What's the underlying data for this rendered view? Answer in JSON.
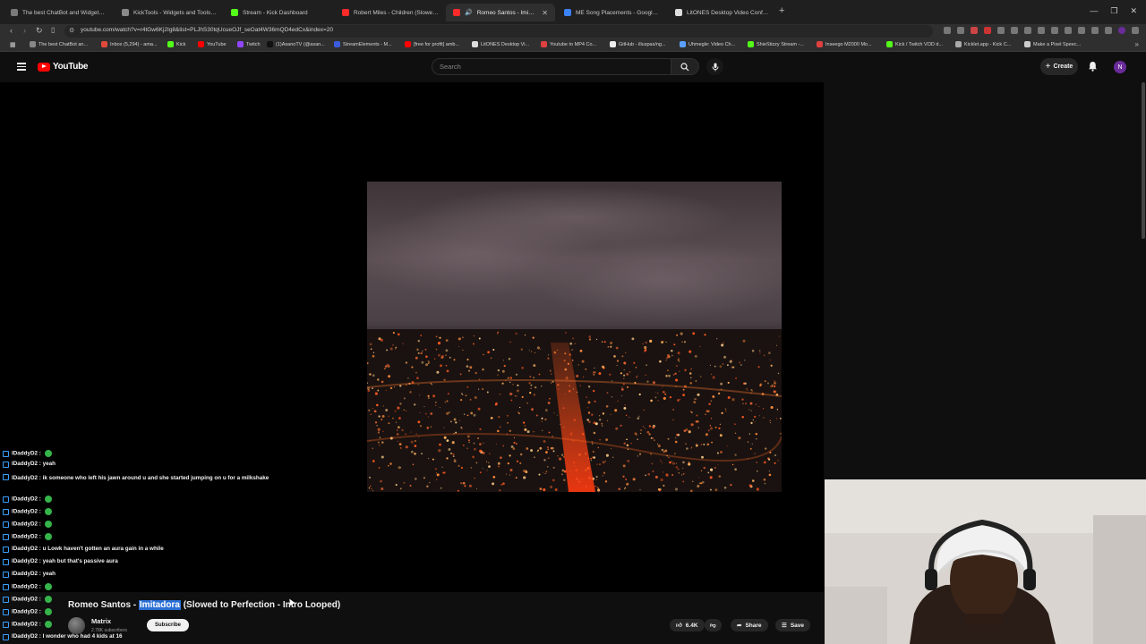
{
  "browser": {
    "tabs": [
      {
        "label": "The best ChatBot and Widgets for K",
        "color": "#7a7a7a"
      },
      {
        "label": "KickTools - Widgets and Tools for Ki",
        "color": "#8a8a8a"
      },
      {
        "label": "Stream - Kick Dashboard",
        "color": "#53fc18"
      },
      {
        "label": "Robert Miles - Children (Slowed — E",
        "color": "#ff2a2a"
      },
      {
        "label": "Romeo Santos - Imitadora (S",
        "color": "#ff2a2a",
        "active": true
      },
      {
        "label": "ME Song Placements - Google Docs",
        "color": "#3b82f6"
      },
      {
        "label": "LitONES Desktop Video Conference",
        "color": "#dddddd"
      }
    ],
    "new_tab": "+",
    "url": "youtube.com/watch?v=r4tGw6Kj2Ig8&list=PLJhS30tqUcueOJf_seOat4W36mQD4edCx&index=20",
    "bookmarks": [
      {
        "label": "The best ChatBot an...",
        "color": "#888"
      },
      {
        "label": "Inbox (5,294) - ama...",
        "color": "#e0493a"
      },
      {
        "label": "Kick",
        "color": "#53fc18"
      },
      {
        "label": "YouTube",
        "color": "#ff0000"
      },
      {
        "label": "Twitch",
        "color": "#9146ff"
      },
      {
        "label": "(1)AsanoTV (@asan...",
        "color": "#111111"
      },
      {
        "label": "StreamElements - M...",
        "color": "#3b5bdb"
      },
      {
        "label": "[free for profit] amb...",
        "color": "#ff0000"
      },
      {
        "label": "LitONES Desktop Vi...",
        "color": "#dddddd"
      },
      {
        "label": "Youtube to MP4 Co...",
        "color": "#e04040"
      },
      {
        "label": "GitHub - illuspas/ng...",
        "color": "#eeeeee"
      },
      {
        "label": "Uhmegle: Video Ch...",
        "color": "#5aa0ff"
      },
      {
        "label": "ShieStizzy Stream -...",
        "color": "#53fc18"
      },
      {
        "label": "Inseego M2000 Mo...",
        "color": "#e04040"
      },
      {
        "label": "Kick / Twitch VOD d...",
        "color": "#53fc18"
      },
      {
        "label": "Kicklet.app - Kick C...",
        "color": "#aaaaaa"
      },
      {
        "label": "Make a Pixel Speec...",
        "color": "#cccccc"
      }
    ]
  },
  "youtube": {
    "logo_text": "YouTube",
    "search_placeholder": "Search",
    "create_label": "Create",
    "avatar_letter": "N",
    "video": {
      "title_before": "Romeo Santos - ",
      "title_highlight": "Imitadora",
      "title_after": " (Slowed to Perfection - Intro Looped)",
      "channel": "Matrix",
      "subscribers": "2.78K subscribers",
      "subscribe_label": "Subscribe",
      "likes": "6.4K",
      "share_label": "Share",
      "save_label": "Save"
    }
  },
  "chat": {
    "messages": [
      {
        "user": "lDaddyD2",
        "text": "",
        "emote": true
      },
      {
        "user": "lDaddyD2",
        "text": "yeah",
        "emote": false
      },
      {
        "user": "lDaddyD2",
        "text": "ik someone who left his jawn around u and she started jumping on u for a milkshake",
        "emote": false,
        "wrap": true
      },
      {
        "user": "lDaddyD2",
        "text": "",
        "emote": true
      },
      {
        "user": "lDaddyD2",
        "text": "",
        "emote": true
      },
      {
        "user": "lDaddyD2",
        "text": "",
        "emote": true
      },
      {
        "user": "lDaddyD2",
        "text": "",
        "emote": true
      },
      {
        "user": "lDaddyD2",
        "text": "u Lowk haven't gotten an aura gain in a while",
        "emote": false
      },
      {
        "user": "lDaddyD2",
        "text": "yeah but that's passive aura",
        "emote": false
      },
      {
        "user": "lDaddyD2",
        "text": "yeah",
        "emote": false
      },
      {
        "user": "lDaddyD2",
        "text": "",
        "emote": true
      },
      {
        "user": "lDaddyD2",
        "text": "",
        "emote": true
      },
      {
        "user": "lDaddyD2",
        "text": "",
        "emote": true
      },
      {
        "user": "lDaddyD2",
        "text": "",
        "emote": true
      },
      {
        "user": "lDaddyD2",
        "text": "I wonder who had 4 kids at 16",
        "emote": false
      }
    ]
  }
}
